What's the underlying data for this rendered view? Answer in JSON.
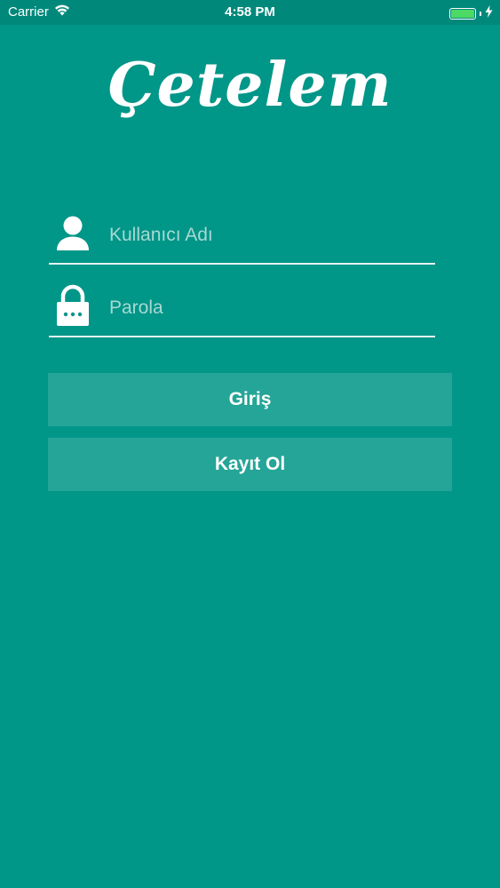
{
  "status_bar": {
    "carrier": "Carrier",
    "time": "4:58 PM",
    "battery_level": 1.0,
    "battery_color": "#4cd964",
    "wifi_icon": "wifi-icon",
    "charging_icon": "bolt-icon"
  },
  "logo": {
    "text": "Çetelem"
  },
  "form": {
    "username": {
      "icon": "user-icon",
      "placeholder": "Kullanıcı Adı",
      "value": ""
    },
    "password": {
      "icon": "lock-icon",
      "placeholder": "Parola",
      "value": ""
    }
  },
  "buttons": {
    "login_label": "Giriş",
    "register_label": "Kayıt Ol"
  },
  "colors": {
    "background": "#009688",
    "button": "#24a597",
    "field_line": "#e6f3f1"
  }
}
